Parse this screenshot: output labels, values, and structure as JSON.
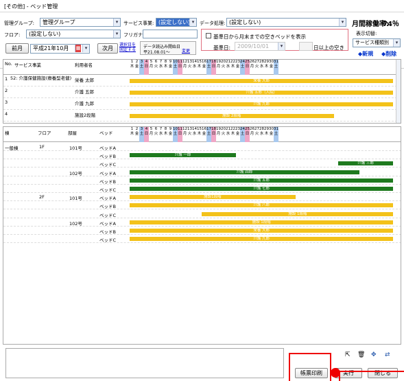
{
  "window": {
    "title": "[その他] - ベッド管理"
  },
  "toolbar": {
    "mgmt_group_label": "管理グループ:",
    "mgmt_group_value": "管理グループ",
    "service_label": "サービス事業:",
    "service_value": "(設定しない)",
    "data_label": "データ処理:",
    "data_value": "(設定しない)",
    "occupancy_label": "月間稼働率:",
    "occupancy_value": "74％",
    "floor_label": "フロア:",
    "floor_value": "(設定しない)",
    "kana_label": "フリガナ:",
    "kana_value": "",
    "prev_month": "前月",
    "month_value": "平成21年10月",
    "next_month": "次月",
    "select_link": "選択日を",
    "month_link": "固定する",
    "load_date_label": "データ読込み開始日",
    "load_date_value": "平21.08.01～",
    "change_link": "変更",
    "check_label": "基準日から月末までの空きベッドを表示",
    "base_date_label": "基準日:",
    "base_date_value": "2009/10/01",
    "days_value": "",
    "days_suffix": "日以上の空き",
    "display_label": "表示切替:",
    "display_value": "サービス種類別",
    "new_link": "◆新規",
    "delete_link": "◆削除"
  },
  "upper": {
    "headers": {
      "no": "No.",
      "service": "サービス事業",
      "user": "利用者名"
    },
    "rows": [
      {
        "no": "1",
        "service": "52: 介護保健施設(療養型老健)",
        "user": "栄養 太郎",
        "bar": "栄養 大郎"
      },
      {
        "no": "2",
        "service": "",
        "user": "介護 五郎",
        "bar": "介護 五郎（入院）"
      },
      {
        "no": "3",
        "service": "",
        "user": "介護 九郎",
        "bar": "介護 九郎"
      },
      {
        "no": "4",
        "service": "",
        "user": "施設2段階",
        "bar": "施設 2段階"
      }
    ]
  },
  "calendar": {
    "days": [
      "1",
      "2",
      "3",
      "4",
      "5",
      "6",
      "7",
      "8",
      "9",
      "10",
      "11",
      "12",
      "13",
      "14",
      "15",
      "16",
      "17",
      "18",
      "19",
      "20",
      "21",
      "22",
      "23",
      "24",
      "25",
      "26",
      "27",
      "28",
      "29",
      "30",
      "31"
    ],
    "weekdays": [
      "木",
      "金",
      "土",
      "日",
      "月",
      "火",
      "水",
      "木",
      "金",
      "土",
      "日",
      "月",
      "火",
      "水",
      "木",
      "金",
      "土",
      "日",
      "月",
      "火",
      "水",
      "木",
      "金",
      "土",
      "日",
      "月",
      "火",
      "水",
      "木",
      "金",
      "土"
    ]
  },
  "lower": {
    "headers": {
      "ward": "棟",
      "floor": "フロア",
      "room": "部屋",
      "bed": "ベッド"
    },
    "rows": [
      {
        "ward": "一般棟",
        "floor": "1F",
        "room": "101号",
        "bed": "ベッドA",
        "bar": ""
      },
      {
        "ward": "",
        "floor": "",
        "room": "",
        "bed": "ベッドB",
        "bar": "介護 一郎"
      },
      {
        "ward": "",
        "floor": "",
        "room": "",
        "bed": "ベッドC",
        "bar": "介護 三郎"
      },
      {
        "ward": "",
        "floor": "",
        "room": "102号",
        "bed": "ベッドA",
        "bar": "介護 四郎"
      },
      {
        "ward": "",
        "floor": "",
        "room": "",
        "bed": "ベッドB",
        "bar": "介護 五郎"
      },
      {
        "ward": "",
        "floor": "",
        "room": "",
        "bed": "ベッドC",
        "bar": "介護 七郎"
      },
      {
        "ward": "",
        "floor": "2F",
        "room": "101号",
        "bed": "ベッドA",
        "bar": "施設1段階"
      },
      {
        "ward": "",
        "floor": "",
        "room": "",
        "bed": "ベッドB",
        "bar": "介護 八郎"
      },
      {
        "ward": "",
        "floor": "",
        "room": "",
        "bed": "ベッドC",
        "bar": "施設 1段階"
      },
      {
        "ward": "",
        "floor": "",
        "room": "102号",
        "bed": "ベッドA",
        "bar": "施設 1段階"
      },
      {
        "ward": "",
        "floor": "",
        "room": "",
        "bed": "ベッドB",
        "bar": "栄養 大郎"
      },
      {
        "ward": "",
        "floor": "",
        "room": "",
        "bed": "ベッドC",
        "bar": "介護 九郎"
      }
    ]
  },
  "footer": {
    "print_button": "帳票印刷",
    "exec_button": "実行",
    "close_button": "閉じる"
  },
  "colors": {
    "yellow_bar": "#f3c21a",
    "green_bar": "#1e7a1e",
    "saturday": "#a9c9ef",
    "sunday": "#f0a7c6",
    "callout": "#e00000"
  }
}
